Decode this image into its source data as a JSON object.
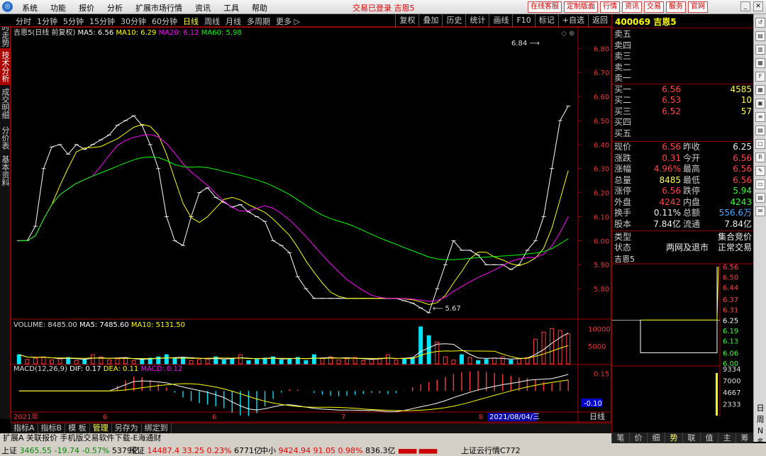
{
  "menu": [
    "系统",
    "功能",
    "报价",
    "分析",
    "扩展市场行情",
    "资讯",
    "工具",
    "帮助"
  ],
  "window_title": "交易已登录  吉恩5",
  "title_buttons": [
    "在线客服",
    "定制版面",
    "行情",
    "资讯",
    "交易",
    "服务",
    "官网"
  ],
  "periods": [
    "分时",
    "1分钟",
    "5分钟",
    "15分钟",
    "30分钟",
    "60分钟",
    "日线",
    "周线",
    "月线",
    "多周期",
    "更多 ▷"
  ],
  "active_period": "日线",
  "toolbar_right": [
    "复权",
    "叠加",
    "历史",
    "统计",
    "画线",
    "F10",
    "标记",
    "+自选",
    "返回"
  ],
  "left_tabs": [
    "分时走势",
    "技术分析",
    "成交明细",
    "分价表",
    "基本资料"
  ],
  "ma_legend": {
    "name": "吉恩5(日线 前复权)",
    "ma5": "MA5: 6.56",
    "ma10": "MA10: 6.29",
    "ma20": "MA20: 6.12",
    "ma60": "MA60: 5.98"
  },
  "annot_high": "6.84",
  "annot_low": "5.67",
  "vol_legend": {
    "vol": "VOLUME: 8485.00",
    "ma5": "MA5: 7485.60",
    "ma10": "MA10: 5131.50"
  },
  "macd_legend": {
    "name": "MACD(12,26,9)",
    "dif": "DIF: 0.17",
    "dea": "DEA: 0.11",
    "macd": "MACD: 0.12"
  },
  "price_ticks": [
    "6.80",
    "6.70",
    "6.60",
    "6.50",
    "6.40",
    "6.30",
    "6.20",
    "6.10",
    "6.00",
    "5.90",
    "5.80"
  ],
  "vol_ticks": [
    "10000",
    "5000"
  ],
  "macd_ticks": [
    "0.15",
    "-0.10"
  ],
  "x_ticks": [
    "2021年",
    "6",
    "6",
    "7",
    "8"
  ],
  "x_cursor_date": "2021/08/04/三",
  "axis_mode": "日线",
  "bottom_tabs": [
    "指标A",
    "指标B",
    "模 板",
    "管理",
    "另存为",
    "绑定到"
  ],
  "bottom_active": "管理",
  "info_bar": "扩展A  关联报价  手机版交易软件下载-E海通财",
  "stock": {
    "code": "400069",
    "name": "吉恩5"
  },
  "orderbook": [
    {
      "label": "卖五",
      "price": "",
      "vol": ""
    },
    {
      "label": "卖四",
      "price": "",
      "vol": ""
    },
    {
      "label": "卖三",
      "price": "",
      "vol": ""
    },
    {
      "label": "卖二",
      "price": "",
      "vol": ""
    },
    {
      "label": "卖一",
      "price": "",
      "vol": ""
    },
    {
      "label": "买一",
      "price": "6.56",
      "vol": "4585"
    },
    {
      "label": "买二",
      "price": "6.53",
      "vol": "10"
    },
    {
      "label": "买三",
      "price": "6.52",
      "vol": "57"
    },
    {
      "label": "买四",
      "price": "",
      "vol": ""
    },
    {
      "label": "买五",
      "price": "",
      "vol": ""
    }
  ],
  "quote_rows": [
    {
      "l1": "现价",
      "v1": "6.56",
      "c1": "red",
      "l2": "昨收",
      "v2": "6.25",
      "c2": "wht"
    },
    {
      "l1": "涨跌",
      "v1": "0.31",
      "c1": "red",
      "l2": "今开",
      "v2": "6.56",
      "c2": "red"
    },
    {
      "l1": "涨幅",
      "v1": "4.96%",
      "c1": "red",
      "l2": "最高",
      "v2": "6.56",
      "c2": "red"
    },
    {
      "l1": "总量",
      "v1": "8485",
      "c1": "yel",
      "l2": "最低",
      "v2": "6.56",
      "c2": "red"
    },
    {
      "l1": "涨停",
      "v1": "6.56",
      "c1": "red",
      "l2": "跌停",
      "v2": "5.94",
      "c2": "grn"
    },
    {
      "l1": "外盘",
      "v1": "4242",
      "c1": "red",
      "l2": "内盘",
      "v2": "4243",
      "c2": "grn"
    },
    {
      "l1": "换手",
      "v1": "0.11%",
      "c1": "wht",
      "l2": "总额",
      "v2": "556.6万",
      "c2": "blu"
    },
    {
      "l1": "股本",
      "v1": "7.84亿",
      "c1": "wht",
      "l2": "流通",
      "v2": "7.84亿",
      "c2": "wht"
    }
  ],
  "type_row": {
    "label": "类型",
    "value": "集合竞价"
  },
  "state_row": {
    "label": "状态",
    "value1": "两网及退市",
    "value2": "正常交易"
  },
  "mini_name": "吉恩5",
  "mini_price_ticks": [
    "6.56",
    "6.50",
    "6.44",
    "6.37",
    "6.31",
    "6.25",
    "6.19",
    "6.13",
    "6.06",
    "6.00"
  ],
  "mini_vol_ticks": [
    "9334",
    "7000",
    "4667",
    "2333"
  ],
  "right_tabs": [
    "笔",
    "价",
    "细",
    "势",
    "联",
    "值",
    "主",
    "筹"
  ],
  "right_active": "势",
  "status": [
    {
      "name": "上证",
      "value": "3465.55",
      "chg": "-19.74",
      "pct": "-0.57%",
      "amt": "5379亿",
      "color": "grn"
    },
    {
      "name": "深证",
      "value": "14487.4",
      "chg": "33.25",
      "pct": "0.23%",
      "amt": "6771亿",
      "color": "red"
    },
    {
      "name": "中小",
      "value": "9424.94",
      "chg": "91.05",
      "pct": "0.98%",
      "amt": "836.3亿",
      "color": "red"
    }
  ],
  "status_right": "上证云行情C772",
  "colors": {
    "up": "#ff3b3b",
    "down": "#3fff3f",
    "ma5": "#ffffff",
    "ma10": "#ffff00",
    "ma20": "#ff00ff",
    "ma60": "#00ff00",
    "volbar": "#00e5ff"
  }
}
